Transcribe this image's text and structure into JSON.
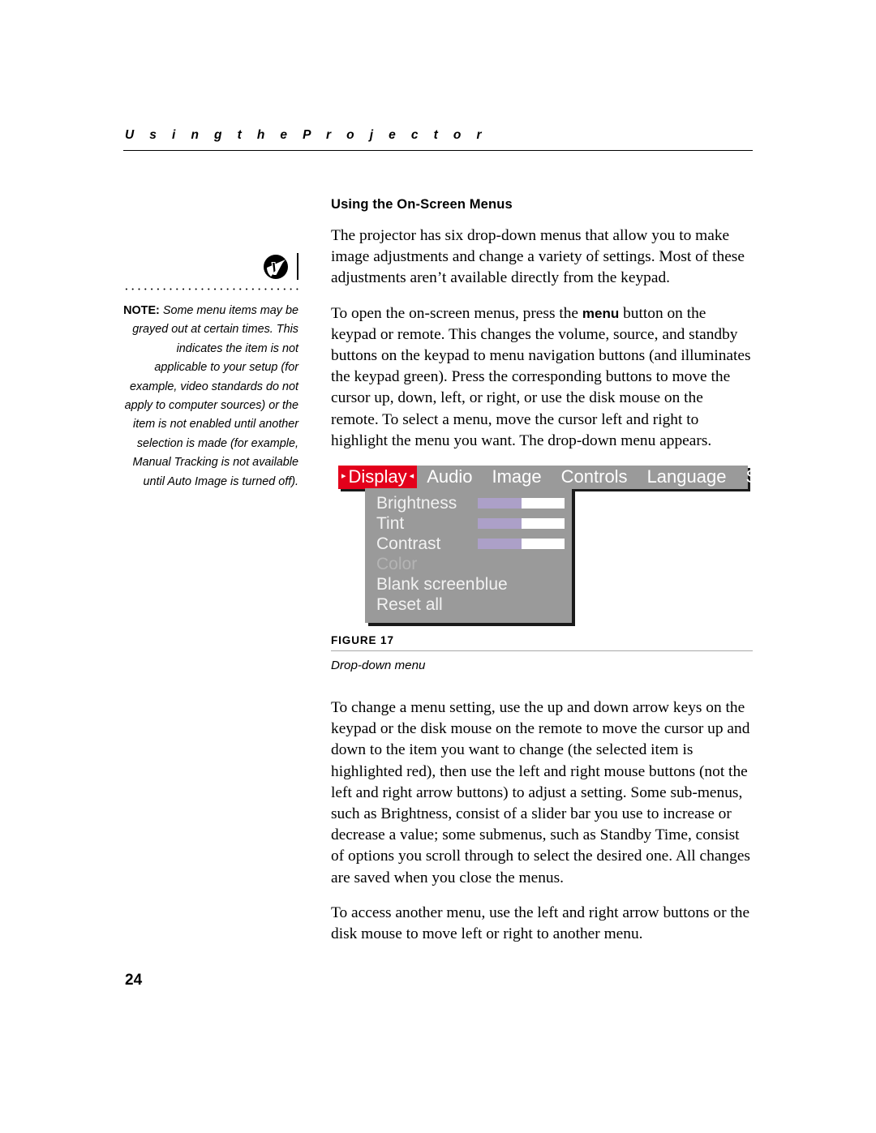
{
  "header": {
    "running_head": "U s i n g   t h e   P r o j e c t o r"
  },
  "note": {
    "icon": "note-lightning-badge-icon",
    "label": "NOTE:",
    "text": " Some menu items may be grayed out at certain times. This indicates the item is not applicable to your setup (for example, video standards do not apply to computer sources) or the item is not enabled until another selection is made (for example, Manual Tracking is not available until Auto Image is turned off)."
  },
  "main": {
    "heading": "Using the On-Screen Menus",
    "paragraph_1": "The projector has six drop-down menus that allow you to make image adjustments and change a variety of settings. Most of these adjustments aren’t available directly from the keypad.",
    "paragraph_2_a": "To open the on-screen menus, press the ",
    "paragraph_2_bold": "menu",
    "paragraph_2_b": " button on the keypad or remote. This changes the volume, source, and standby buttons on the keypad to menu navigation buttons (and illuminates the keypad green). Press the corresponding buttons to move the cursor up, down, left, or right, or use the disk mouse on the remote. To select a menu, move the cursor left and right to highlight the menu you want. The drop-down menu appears.",
    "paragraph_3": "To change a menu setting, use the up and down arrow keys on the keypad or the disk mouse on the remote to move the cursor up and down to the item you want to change (the selected item is highlighted red), then use the left and right mouse buttons (not the left and right arrow buttons) to adjust a setting. Some sub-menus, such as Brightness, consist of a slider bar you use to increase or decrease a value; some submenus, such as Standby Time, consist of options you scroll through to select the desired one. All changes are saved when you close the menus.",
    "paragraph_4": "To access another menu, use the left and right arrow buttons or the disk mouse to move left or right to another menu."
  },
  "osd": {
    "accent_color": "#e3001b",
    "bar_color": "#9a9a9a",
    "slider_fill_color": "#aca0c8",
    "slider_track_color": "#ffffff",
    "caret_left": "▸",
    "caret_right": "◂",
    "tabs": [
      {
        "label": "Display",
        "active": true
      },
      {
        "label": "Audio",
        "active": false
      },
      {
        "label": "Image",
        "active": false
      },
      {
        "label": "Controls",
        "active": false
      },
      {
        "label": "Language",
        "active": false
      },
      {
        "label": "Status",
        "active": false
      }
    ],
    "items": [
      {
        "label": "Brightness",
        "type": "slider",
        "percent": 50,
        "disabled": false
      },
      {
        "label": "Tint",
        "type": "slider",
        "percent": 50,
        "disabled": false
      },
      {
        "label": "Contrast",
        "type": "slider",
        "percent": 50,
        "disabled": false
      },
      {
        "label": "Color",
        "type": "none",
        "disabled": true
      },
      {
        "label": "Blank screen",
        "type": "value",
        "value": "blue",
        "disabled": false
      },
      {
        "label": "Reset all",
        "type": "none",
        "disabled": false
      }
    ]
  },
  "figure": {
    "label": "FIGURE 17",
    "description": "Drop-down menu"
  },
  "footer": {
    "page_number": "24"
  }
}
